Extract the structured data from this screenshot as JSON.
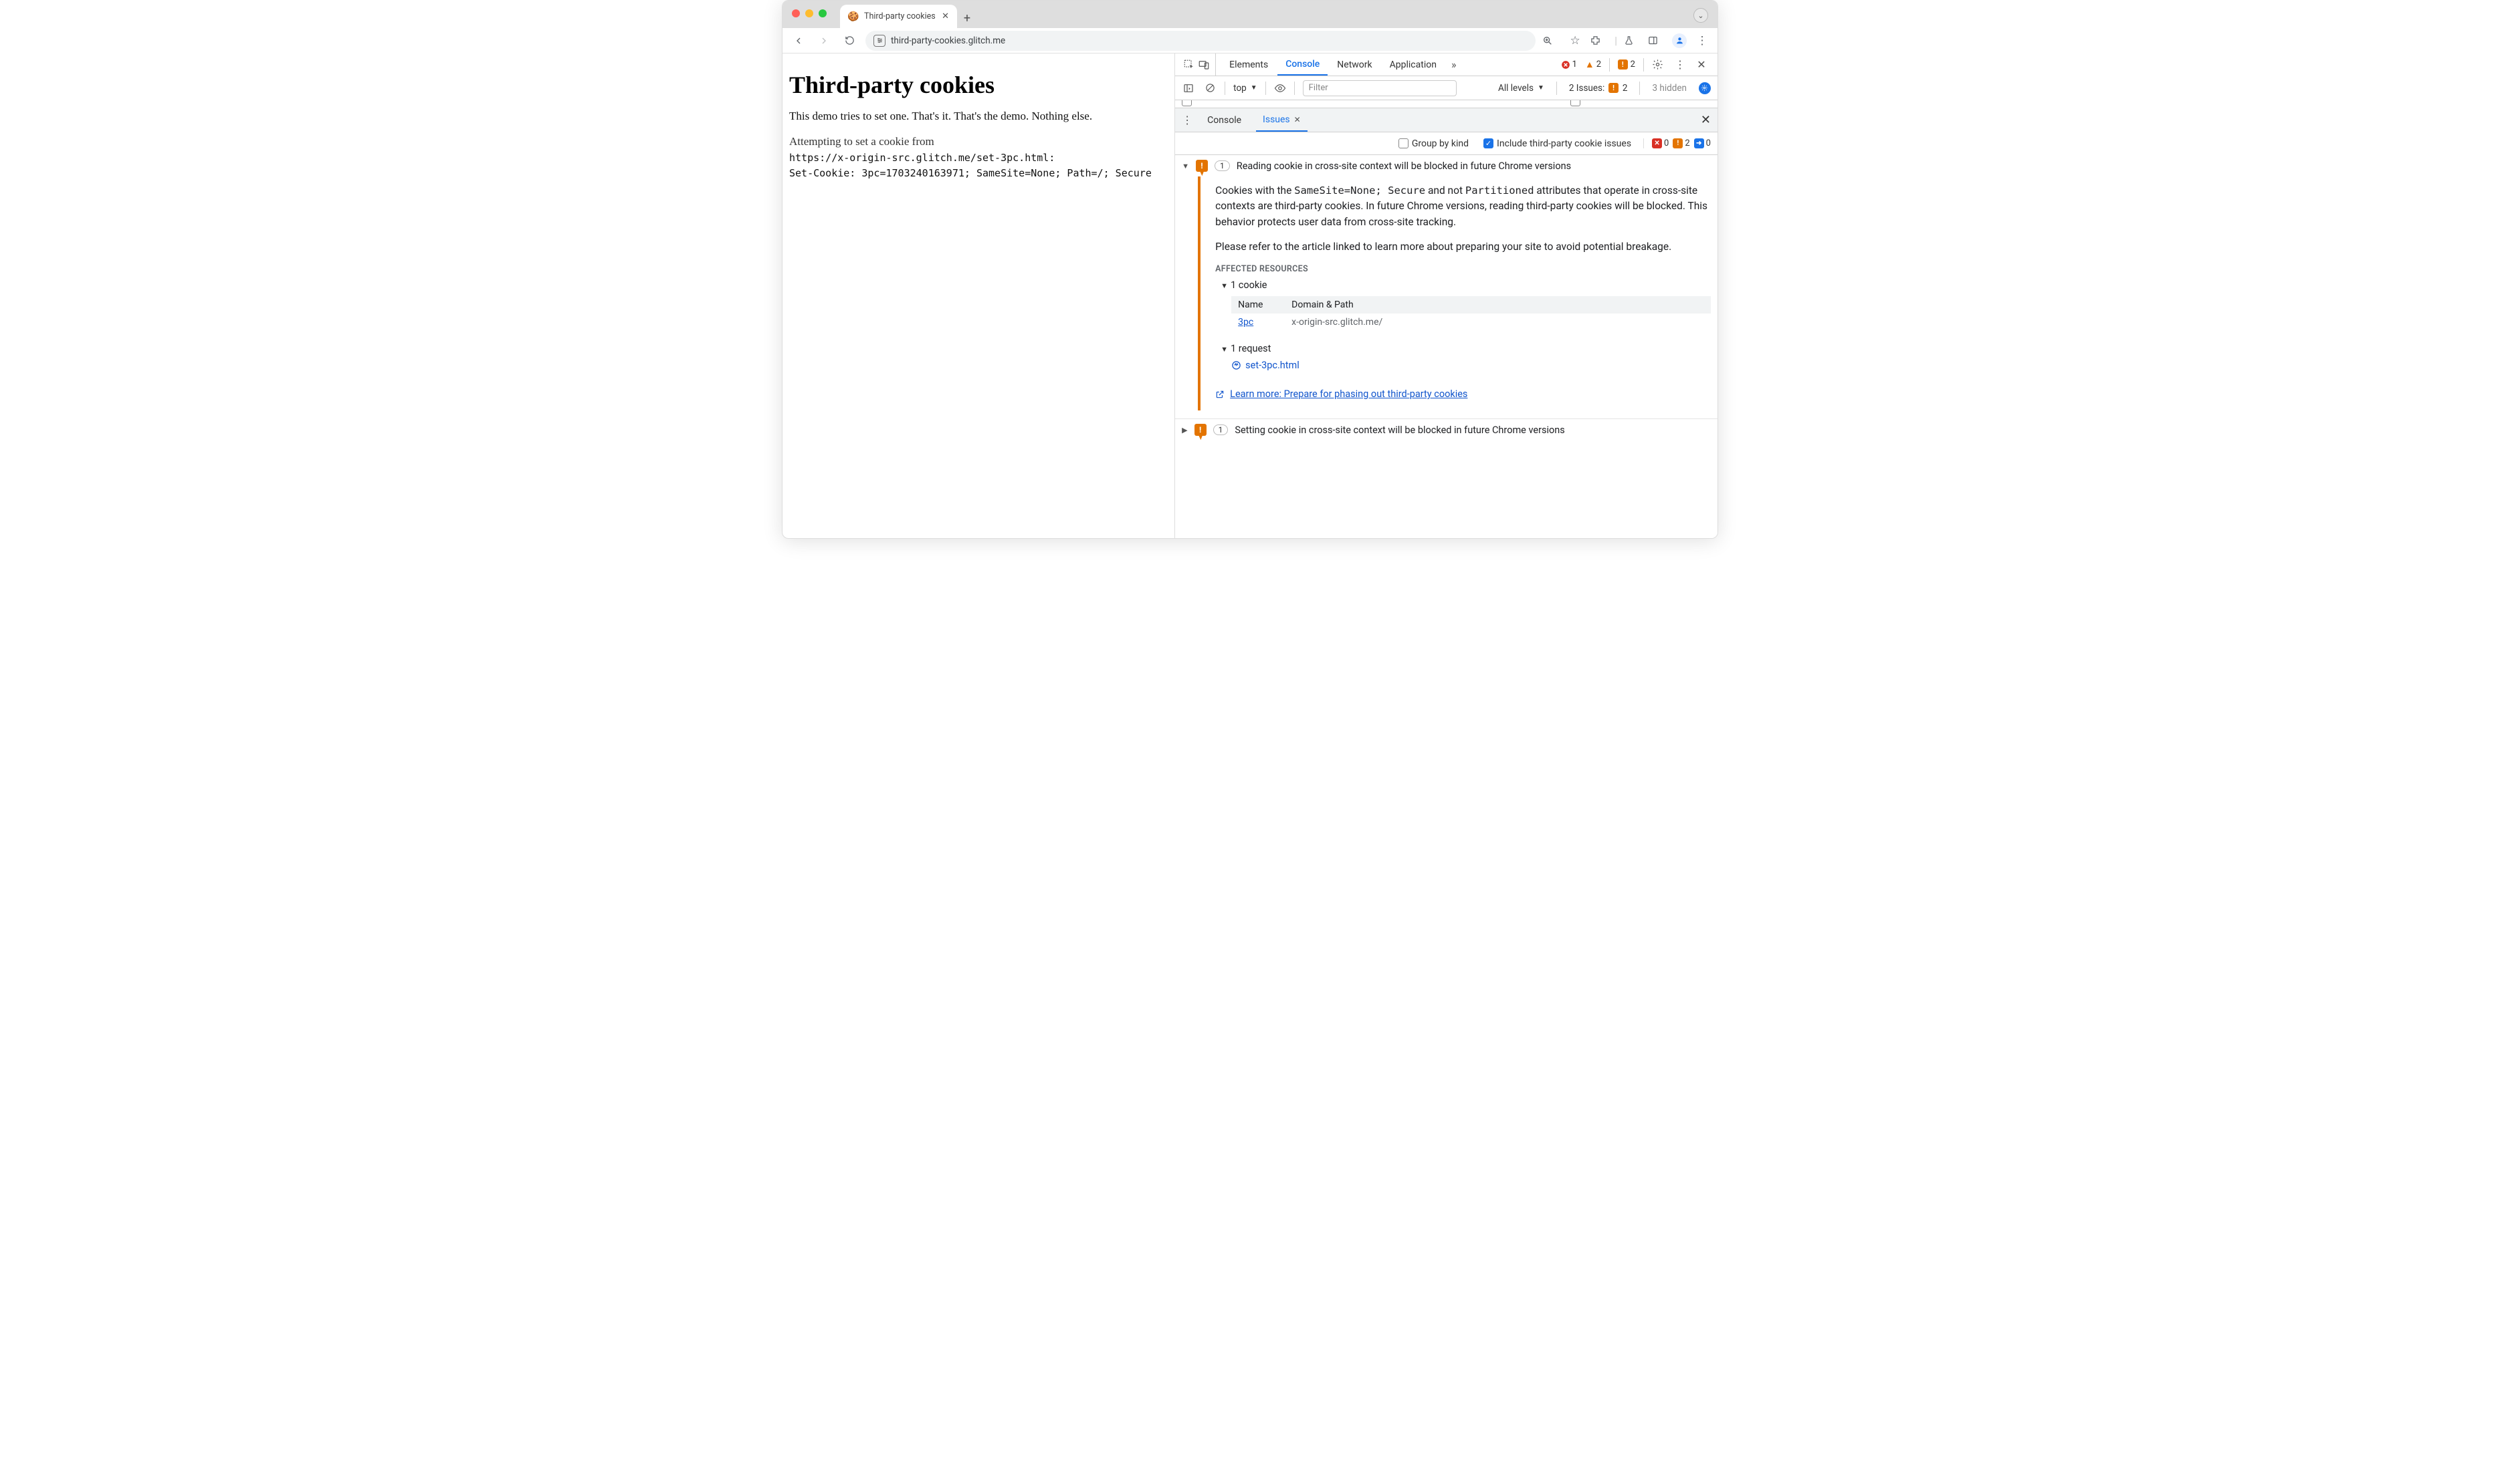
{
  "browser": {
    "tab_title": "Third-party cookies",
    "url": "third-party-cookies.glitch.me"
  },
  "page": {
    "h1": "Third-party cookies",
    "intro": "This demo tries to set one. That's it. That's the demo. Nothing else.",
    "attempt_line": "Attempting to set a cookie from",
    "mono1": "https://x-origin-src.glitch.me/set-3pc.html:",
    "mono2": "Set-Cookie: 3pc=1703240163971; SameSite=None; Path=/; Secure"
  },
  "devtools": {
    "tabs": [
      "Elements",
      "Console",
      "Network",
      "Application"
    ],
    "active_tab": "Console",
    "errors_count": "1",
    "warnings_count": "2",
    "issues_count": "2",
    "context": "top",
    "filter_placeholder": "Filter",
    "levels_label": "All levels",
    "issues_label": "2 Issues:",
    "issues_badge": "2",
    "hidden_label": "3 hidden",
    "drawer_tabs": [
      "Console",
      "Issues"
    ],
    "drawer_active": "Issues",
    "issues_toolbar": {
      "group_label": "Group by kind",
      "include_label": "Include third-party cookie issues"
    },
    "mini_badges": {
      "red": "0",
      "orange": "2",
      "blue": "0"
    },
    "issue1": {
      "count": "1",
      "title": "Reading cookie in cross-site context will be blocked in future Chrome versions",
      "body1a": "Cookies with the ",
      "body1b": "SameSite=None; Secure",
      "body1c": " and not ",
      "body1d": "Partitioned",
      "body1e": " attributes that operate in cross-site contexts are third-party cookies. In future Chrome versions, reading third-party cookies will be blocked. This behavior protects user data from cross-site tracking.",
      "body2": "Please refer to the article linked to learn more about preparing your site to avoid potential breakage.",
      "aff_head": "Affected Resources",
      "cookie_count_label": "1 cookie",
      "table": {
        "col1": "Name",
        "col2": "Domain & Path",
        "name": "3pc",
        "domain": "x-origin-src.glitch.me/"
      },
      "request_count_label": "1 request",
      "request_name": "set-3pc.html",
      "learn_more": "Learn more: Prepare for phasing out third-party cookies"
    },
    "issue2": {
      "count": "1",
      "title": "Setting cookie in cross-site context will be blocked in future Chrome versions"
    }
  }
}
